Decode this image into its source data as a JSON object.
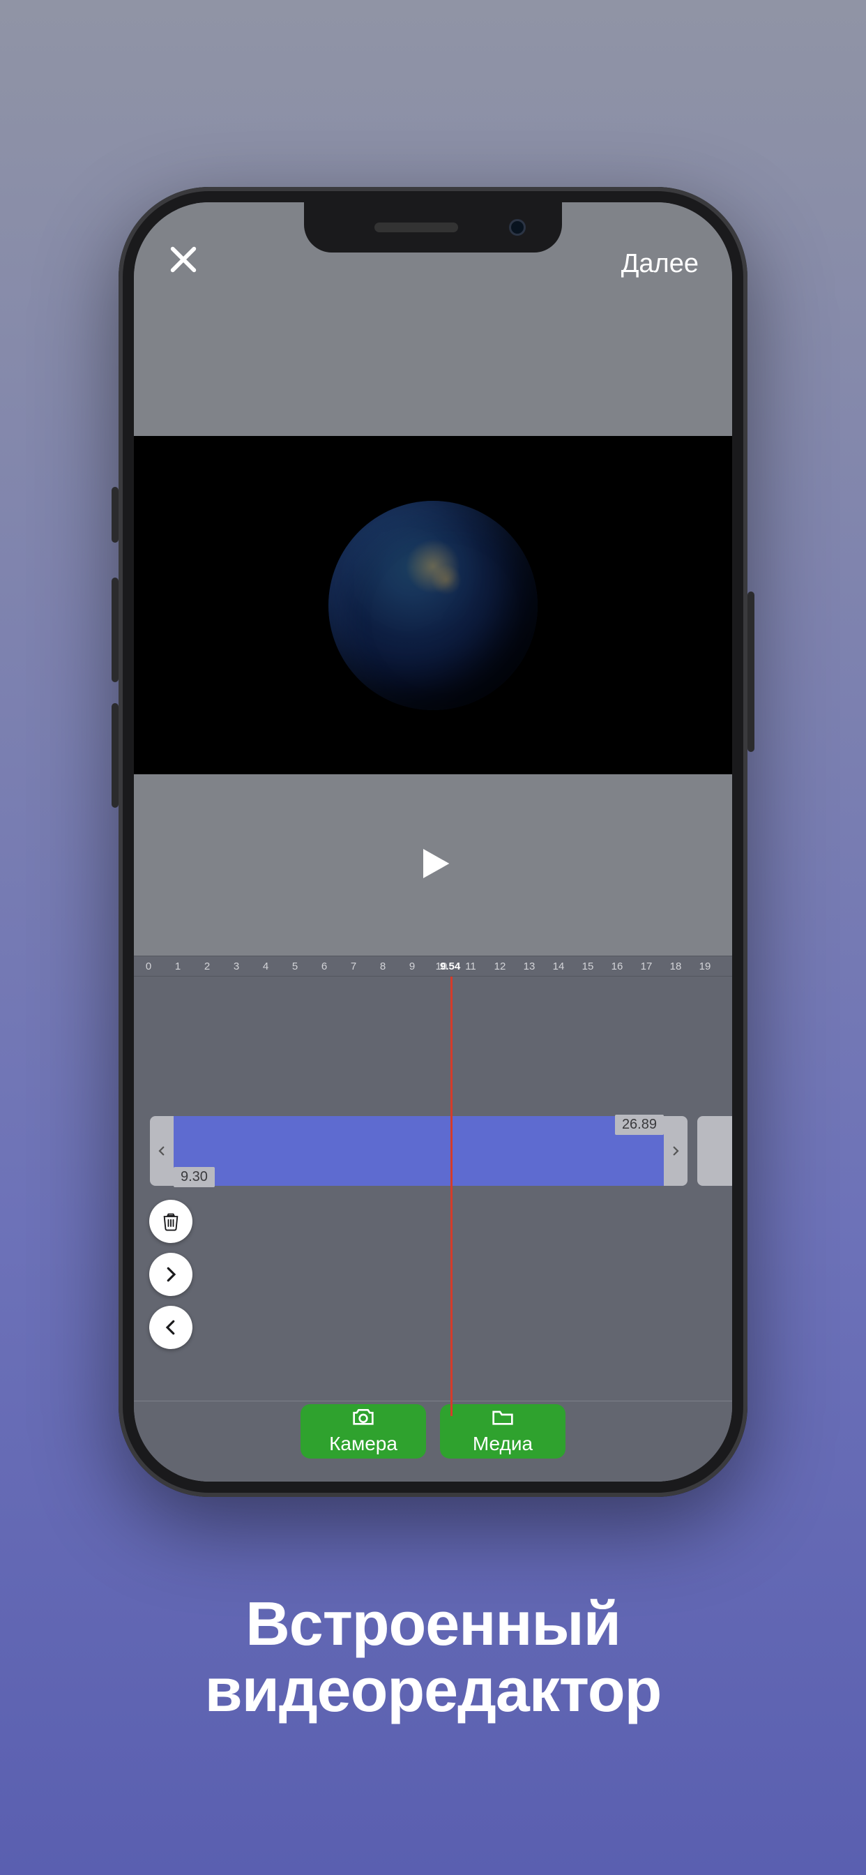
{
  "topbar": {
    "next_label": "Далее"
  },
  "timeline": {
    "ticks": [
      "0",
      "1",
      "2",
      "3",
      "4",
      "5",
      "6",
      "7",
      "8",
      "9",
      "10",
      "11",
      "12",
      "13",
      "14",
      "15",
      "16",
      "17",
      "18",
      "19"
    ],
    "current_position": "9.54"
  },
  "clip": {
    "in_point": "9.30",
    "out_point": "26.89"
  },
  "source_buttons": {
    "camera": "Камера",
    "media": "Медиа"
  },
  "caption": {
    "line1": "Встроенный",
    "line2": "видеоредактор"
  }
}
